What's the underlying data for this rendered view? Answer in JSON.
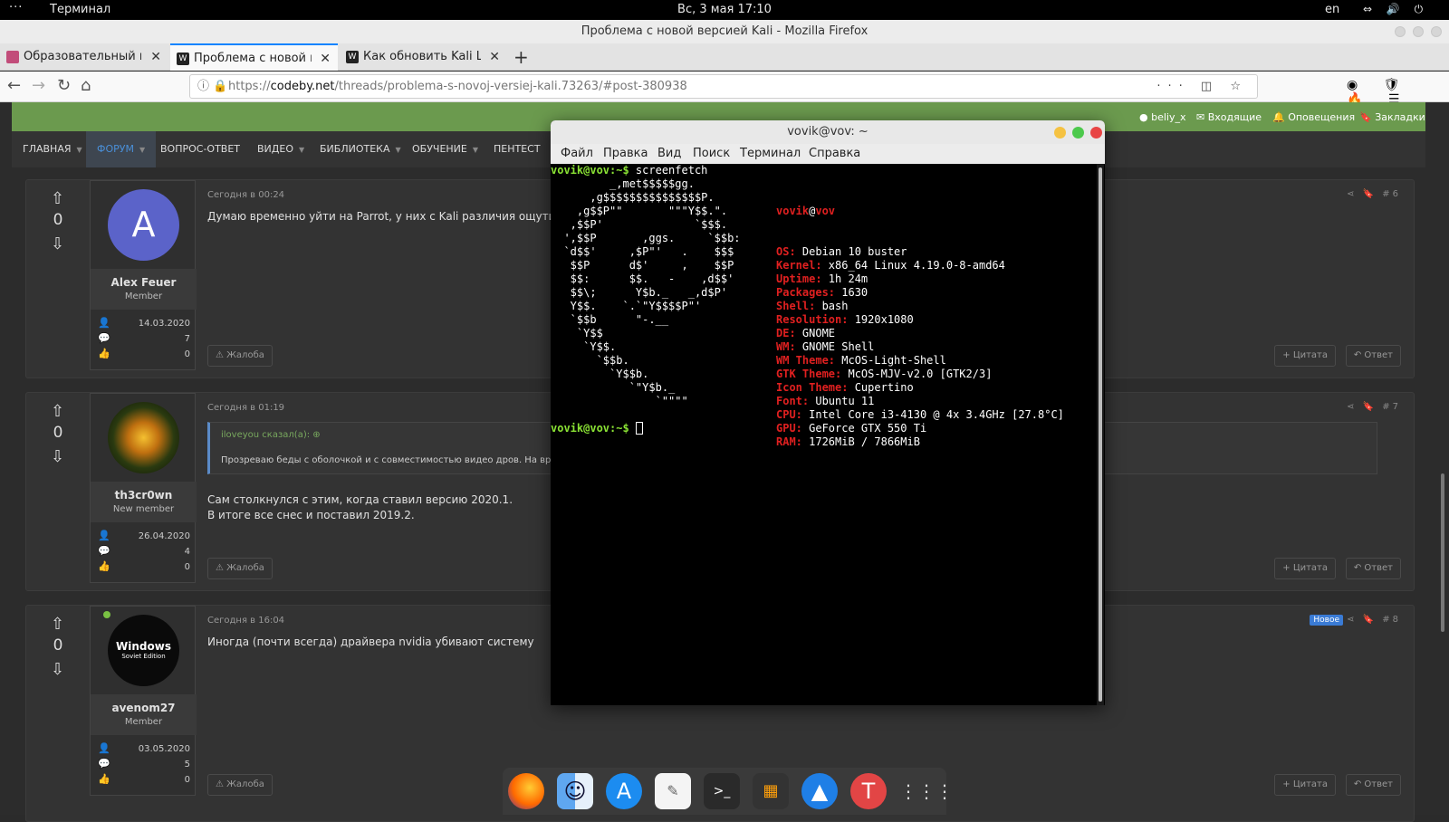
{
  "gnome_bar": {
    "activities": "···",
    "app_name": "Терминал",
    "clock": "Вс, 3 мая  17:10",
    "lang": "en",
    "sys_icons": "⇔ 🔊 ⏻"
  },
  "firefox": {
    "window_title": "Проблема с новой версией Kali - Mozilla Firefox",
    "tabs": [
      {
        "label": "Образовательный по",
        "active": false
      },
      {
        "label": "Проблема с новой ве",
        "active": true
      },
      {
        "label": "Как обновить Kali Lin",
        "active": false
      }
    ],
    "url_prefix": "https://",
    "url_host": "codeby.net",
    "url_path": "/threads/problema-s-novoj-versiej-kali.73263/#post-380938"
  },
  "site": {
    "user_bar": {
      "username": "beliy_x",
      "inbox": "Входящие",
      "alerts": "Оповещения",
      "bookmarks": "Закладки"
    },
    "menu": [
      "ГЛАВНАЯ",
      "ФОРУМ",
      "ВОПРОС-ОТВЕТ",
      "ВИДЕО",
      "БИБЛИОТЕКА",
      "ОБУЧЕНИЕ",
      "ПЕНТЕСТ"
    ],
    "posts": [
      {
        "votes": "0",
        "author": "Alex Feuer",
        "role": "Member",
        "avatar_letter": "A",
        "joined": "14.03.2020",
        "messages": "7",
        "reactions": "0",
        "time": "Сегодня в 00:24",
        "text": "Думаю временно уйти на Parrot, у них с Kali различия ощутимы",
        "number": "#6",
        "report": "Жалоба",
        "quote": "+ Цитата",
        "reply": "Ответ"
      },
      {
        "votes": "0",
        "author": "th3cr0wn",
        "role": "New member",
        "joined": "26.04.2020",
        "messages": "4",
        "reactions": "0",
        "time": "Сегодня в 01:19",
        "quote_author": "iloveyou сказал(а): ⊕",
        "quote_text": "Прозреваю беды с оболочкой и с совместимостью видео дров. На врем",
        "text_line1": "Сам столкнулся с этим, когда ставил версию 2020.1.",
        "text_line2": "В итоге все снес и поставил 2019.2.",
        "number": "#7",
        "report": "Жалоба",
        "quote": "+ Цитата",
        "reply": "Ответ"
      },
      {
        "votes": "0",
        "author": "avenom27",
        "role": "Member",
        "avatar_text": "Windows",
        "avatar_sub": "Soviet Edition",
        "joined": "03.05.2020",
        "messages": "5",
        "reactions": "0",
        "time": "Сегодня в 16:04",
        "text": "Иногда (почти всегда) драйвера nvidia убивают систему",
        "badge": "Новое",
        "number": "#8",
        "report": "Жалоба",
        "quote": "+ Цитата",
        "reply": "Ответ"
      }
    ]
  },
  "terminal": {
    "title": "vovik@vov: ~",
    "menu": [
      "Файл",
      "Правка",
      "Вид",
      "Поиск",
      "Терминал",
      "Справка"
    ],
    "prompt": "vovik@vov:~$",
    "command": " screenfetch",
    "hostline_user": "vovik",
    "hostline_at": "@",
    "hostline_host": "vov",
    "info": [
      {
        "k": "OS:",
        "v": " Debian 10 buster"
      },
      {
        "k": "Kernel:",
        "v": " x86_64 Linux 4.19.0-8-amd64"
      },
      {
        "k": "Uptime:",
        "v": " 1h 24m"
      },
      {
        "k": "Packages:",
        "v": " 1630"
      },
      {
        "k": "Shell:",
        "v": " bash"
      },
      {
        "k": "Resolution:",
        "v": " 1920x1080"
      },
      {
        "k": "DE:",
        "v": " GNOME"
      },
      {
        "k": "WM:",
        "v": " GNOME Shell"
      },
      {
        "k": "WM Theme:",
        "v": " McOS-Light-Shell"
      },
      {
        "k": "GTK Theme:",
        "v": " McOS-MJV-v2.0 [GTK2/3]"
      },
      {
        "k": "Icon Theme:",
        "v": " Cupertino"
      },
      {
        "k": "Font:",
        "v": " Ubuntu 11"
      },
      {
        "k": "CPU:",
        "v": " Intel Core i3-4130 @ 4x 3.4GHz [27.8°C]"
      },
      {
        "k": "GPU:",
        "v": " GeForce GTX 550 Ti"
      },
      {
        "k": "RAM:",
        "v": " 1726MiB / 7866MiB"
      }
    ],
    "ascii": [
      "         _,met$$$$$gg.",
      "      ,g$$$$$$$$$$$$$$$P.",
      "    ,g$$P\"\"       \"\"\"Y$$.\".",
      "   ,$$P'              `$$$.",
      "  ',$$P       ,ggs.     `$$b:",
      "  `d$$'     ,$P\"'   .    $$$",
      "   $$P      d$'     ,    $$P",
      "   $$:      $$.   -    ,d$$'",
      "   $$\\;      Y$b._   _,d$P'",
      "   Y$$.    `.`\"Y$$$$P\"'",
      "   `$$b      \"-.__",
      "    `Y$$",
      "     `Y$$.",
      "       `$$b.",
      "         `Y$$b.",
      "            `\"Y$b._",
      "                `\"\"\"\""
    ],
    "prompt2": "vovik@vov:~$"
  },
  "dock": [
    "firefox-icon",
    "finder-icon",
    "appstore-icon",
    "notes-icon",
    "terminal-icon",
    "calculator-icon",
    "navigator-icon",
    "installer-icon",
    "apps-grid-icon"
  ]
}
